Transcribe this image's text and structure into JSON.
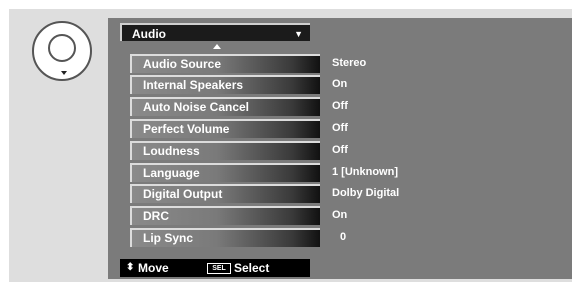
{
  "menu": {
    "title": "Audio",
    "rows": [
      {
        "label": "Audio Source",
        "value": "Stereo"
      },
      {
        "label": "Internal Speakers",
        "value": "On"
      },
      {
        "label": "Auto Noise Cancel",
        "value": "Off"
      },
      {
        "label": "Perfect Volume",
        "value": "Off"
      },
      {
        "label": "Loudness",
        "value": "Off"
      },
      {
        "label": "Language",
        "value": "1 [Unknown]"
      },
      {
        "label": "Digital Output",
        "value": "Dolby Digital"
      },
      {
        "label": "DRC",
        "value": "On"
      },
      {
        "label": "Lip Sync",
        "value": "0"
      }
    ]
  },
  "footer": {
    "move_label": "Move",
    "sel_key": "SEL",
    "select_label": "Select"
  }
}
